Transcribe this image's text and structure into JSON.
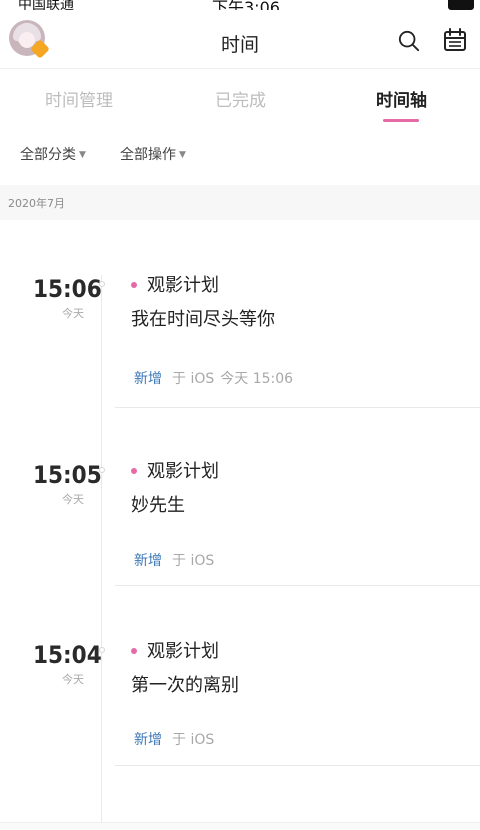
{
  "status_bar": {
    "carrier": "中国联通",
    "time": "下午3:06"
  },
  "header": {
    "title": "时间"
  },
  "tabs": [
    {
      "label": "时间管理"
    },
    {
      "label": "已完成"
    },
    {
      "label": "时间轴",
      "active": true
    }
  ],
  "filters": {
    "category": "全部分类",
    "actions": "全部操作"
  },
  "month_label": "2020年7月",
  "entries": [
    {
      "time": "15:06",
      "day": "今天",
      "category": "观影计划",
      "content": "我在时间尽头等你",
      "action": "新增",
      "source": "于 iOS",
      "extra": "今天 15:06"
    },
    {
      "time": "15:05",
      "day": "今天",
      "category": "观影计划",
      "content": "妙先生",
      "action": "新增",
      "source": "于 iOS",
      "extra": ""
    },
    {
      "time": "15:04",
      "day": "今天",
      "category": "观影计划",
      "content": "第一次的离别",
      "action": "新增",
      "source": "于 iOS",
      "extra": ""
    }
  ],
  "colors": {
    "accent": "#e66aa6",
    "link": "#3b78b8",
    "muted": "#a8a8a8"
  },
  "icons": [
    "avatar",
    "search-icon",
    "calendar-icon",
    "caret-down-icon"
  ]
}
